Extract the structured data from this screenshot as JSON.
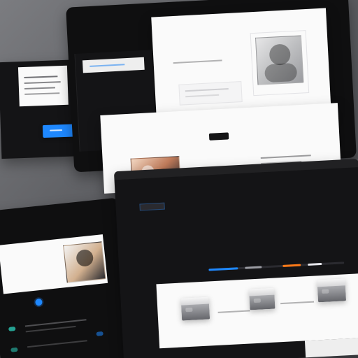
{
  "screens": {
    "top_left": {
      "text_blocks": [
        "",
        "",
        ""
      ],
      "button_label": ""
    },
    "top_right": {
      "nav": "",
      "title": "",
      "subtitle": "",
      "avatar_caption": ""
    },
    "middle": {
      "section_title": "",
      "col_left": "",
      "col_right": ""
    },
    "bottom_left": {
      "hero_text": "",
      "logo_text": ""
    },
    "bottom_main": {
      "hero_line_1": "",
      "hero_line_2": "",
      "hero_line_3": "",
      "progress": {
        "blue": 0.22,
        "gray": 0.12,
        "orange": 0.12,
        "white": 0.08
      },
      "cards": [
        {
          "label": ""
        },
        {
          "label": ""
        },
        {
          "label": ""
        }
      ],
      "footer_text": ""
    }
  },
  "colors": {
    "accent_blue": "#1e88ff",
    "accent_orange": "#ff7a18",
    "accent_teal": "#2dd4bf"
  }
}
